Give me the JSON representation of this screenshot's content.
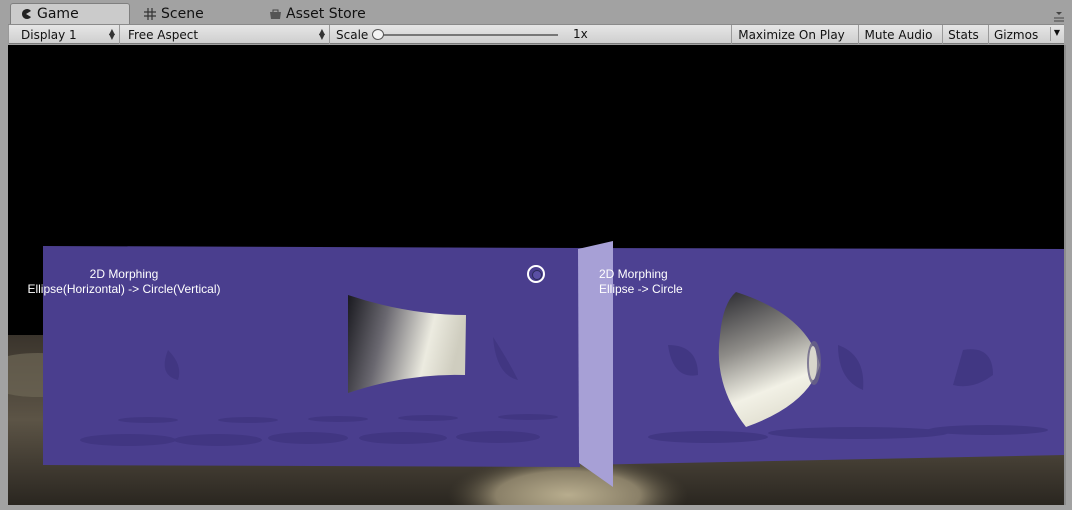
{
  "tabs": [
    {
      "label": "Game",
      "icon": "pacman-icon",
      "active": true
    },
    {
      "label": "Scene",
      "icon": "grid-icon",
      "active": false
    },
    {
      "label": "Asset Store",
      "icon": "shop-icon",
      "active": false
    }
  ],
  "toolbar": {
    "display": "Display 1",
    "aspect": "Free Aspect",
    "scale_label": "Scale",
    "scale_value": "1x",
    "maximize_on_play": "Maximize On Play",
    "mute_audio": "Mute Audio",
    "stats": "Stats",
    "gizmos": "Gizmos"
  },
  "viewport": {
    "labels": [
      {
        "line1": "2D Morphing",
        "line2": "Ellipse(Horizontal) -> Circle(Vertical)"
      },
      {
        "line1": "2D Morphing",
        "line2": "Ellipse -> Circle"
      }
    ],
    "colors": {
      "plane": "#4a3e8e",
      "divider": "#a7a0d6",
      "sky": "#000000"
    }
  }
}
